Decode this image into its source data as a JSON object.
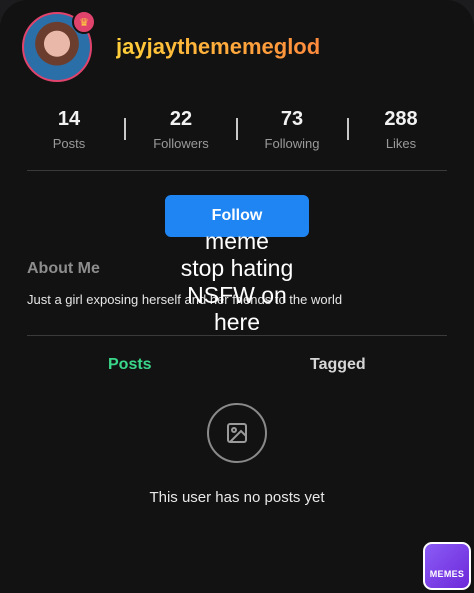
{
  "profile": {
    "username": "jayjaythememeglod",
    "stats": [
      {
        "value": "14",
        "label": "Posts"
      },
      {
        "value": "22",
        "label": "Followers"
      },
      {
        "value": "73",
        "label": "Following"
      },
      {
        "value": "288",
        "label": "Likes"
      }
    ],
    "follow_label": "Follow",
    "about_title": "About Me",
    "bio": "Just a girl exposing herself and her friends to the world"
  },
  "overlay_text": [
    "meme",
    "stop hating",
    "NSFW on",
    "here"
  ],
  "tabs": {
    "posts": "Posts",
    "tagged": "Tagged"
  },
  "empty_state": {
    "message": "This user has no posts yet",
    "icon": "image-icon"
  },
  "watermark": {
    "label": "MEMES"
  },
  "colors": {
    "accent_blue": "#1f85f2",
    "posts_tab_green": "#3ad68a",
    "username_gradient": [
      "#ffcf3a",
      "#ff8a3d"
    ],
    "badge_pink": "#e0436b"
  }
}
